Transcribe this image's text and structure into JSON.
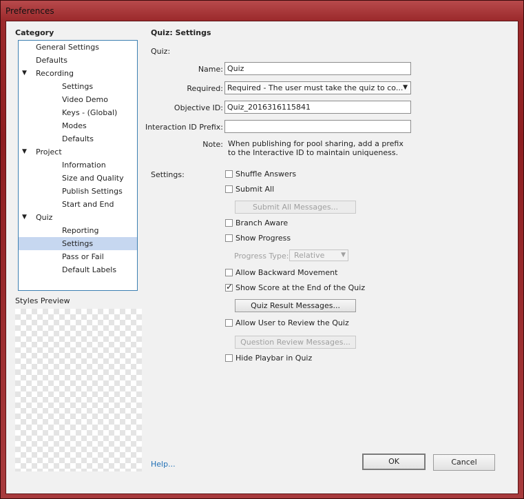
{
  "window": {
    "title": "Preferences"
  },
  "category": {
    "heading": "Category",
    "items": [
      {
        "label": "General Settings",
        "level": 1,
        "expandable": false,
        "selected": false
      },
      {
        "label": "Defaults",
        "level": 1,
        "expandable": false,
        "selected": false
      },
      {
        "label": "Recording",
        "level": 0,
        "expandable": true,
        "selected": false
      },
      {
        "label": "Settings",
        "level": 2,
        "expandable": false,
        "selected": false
      },
      {
        "label": "Video Demo",
        "level": 2,
        "expandable": false,
        "selected": false
      },
      {
        "label": "Keys - (Global)",
        "level": 2,
        "expandable": false,
        "selected": false
      },
      {
        "label": "Modes",
        "level": 2,
        "expandable": false,
        "selected": false
      },
      {
        "label": "Defaults",
        "level": 2,
        "expandable": false,
        "selected": false
      },
      {
        "label": "Project",
        "level": 0,
        "expandable": true,
        "selected": false
      },
      {
        "label": "Information",
        "level": 2,
        "expandable": false,
        "selected": false
      },
      {
        "label": "Size and Quality",
        "level": 2,
        "expandable": false,
        "selected": false
      },
      {
        "label": "Publish Settings",
        "level": 2,
        "expandable": false,
        "selected": false
      },
      {
        "label": "Start and End",
        "level": 2,
        "expandable": false,
        "selected": false
      },
      {
        "label": "Quiz",
        "level": 0,
        "expandable": true,
        "selected": false
      },
      {
        "label": "Reporting",
        "level": 2,
        "expandable": false,
        "selected": false
      },
      {
        "label": "Settings",
        "level": 2,
        "expandable": false,
        "selected": true
      },
      {
        "label": "Pass or Fail",
        "level": 2,
        "expandable": false,
        "selected": false
      },
      {
        "label": "Default Labels",
        "level": 2,
        "expandable": false,
        "selected": false
      }
    ],
    "expand_glyph": "▼"
  },
  "styles_preview": {
    "label": "Styles Preview"
  },
  "panel": {
    "title": "Quiz: Settings",
    "quiz_label": "Quiz:",
    "name_label": "Name:",
    "name_value": "Quiz",
    "required_label": "Required:",
    "required_value": "Required - The user must take the quiz to co...",
    "objective_label": "Objective ID:",
    "objective_value": "Quiz_2016316115841",
    "interaction_label": "Interaction ID Prefix:",
    "interaction_value": "",
    "note_label": "Note:",
    "note_line1": "When publishing for pool sharing, add a prefix",
    "note_line2": "to the Interactive ID to maintain uniqueness.",
    "settings_label": "Settings:"
  },
  "settings": {
    "shuffle_answers": {
      "label": "Shuffle Answers",
      "checked": false
    },
    "submit_all": {
      "label": "Submit All",
      "checked": false
    },
    "submit_all_messages": "Submit All Messages...",
    "branch_aware": {
      "label": "Branch Aware",
      "checked": false
    },
    "show_progress": {
      "label": "Show Progress",
      "checked": false
    },
    "progress_type_label": "Progress Type:",
    "progress_type_value": "Relative",
    "allow_backward": {
      "label": "Allow Backward Movement",
      "checked": false
    },
    "show_score": {
      "label": "Show Score at the End of the Quiz",
      "checked": true
    },
    "quiz_result_messages": "Quiz Result Messages...",
    "allow_review": {
      "label": "Allow User to Review the Quiz",
      "checked": false
    },
    "question_review_messages": "Question Review Messages...",
    "hide_playbar": {
      "label": "Hide Playbar in Quiz",
      "checked": false
    },
    "check_glyph": "✓",
    "dropdown_glyph": "▼"
  },
  "footer": {
    "help": "Help...",
    "ok": "OK",
    "cancel": "Cancel"
  }
}
